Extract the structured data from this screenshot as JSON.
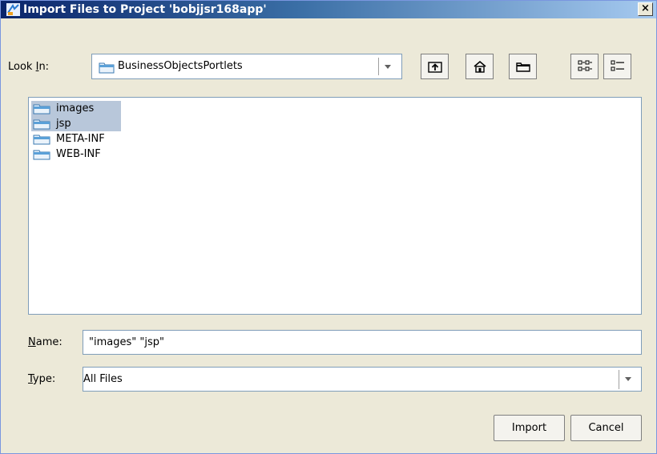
{
  "window": {
    "title": "Import Files to Project 'bobjjsr168app'",
    "close_label": "×"
  },
  "look_in": {
    "label_prefix": "Look ",
    "label_mnemonic": "I",
    "label_suffix": "n:",
    "value": "BusinessObjectsPortlets"
  },
  "toolbar": {
    "icons": [
      "up-one-level-icon",
      "home-icon",
      "new-folder-icon",
      "list-view-icon",
      "details-view-icon"
    ]
  },
  "files": [
    {
      "name": "images",
      "selected": true
    },
    {
      "name": "jsp",
      "selected": true
    },
    {
      "name": "META-INF",
      "selected": false
    },
    {
      "name": "WEB-INF",
      "selected": false
    }
  ],
  "name_field": {
    "label_mnemonic": "N",
    "label_suffix": "ame:",
    "value": "\"images\" \"jsp\""
  },
  "type_field": {
    "label_mnemonic": "T",
    "label_suffix": "ype:",
    "value": "All Files"
  },
  "buttons": {
    "import": "Import",
    "cancel": "Cancel"
  },
  "colors": {
    "title_gradient_start": "#0a246a",
    "title_gradient_end": "#a6caf0",
    "selection": "#b8c7da",
    "folder": "#5aa0d8"
  }
}
